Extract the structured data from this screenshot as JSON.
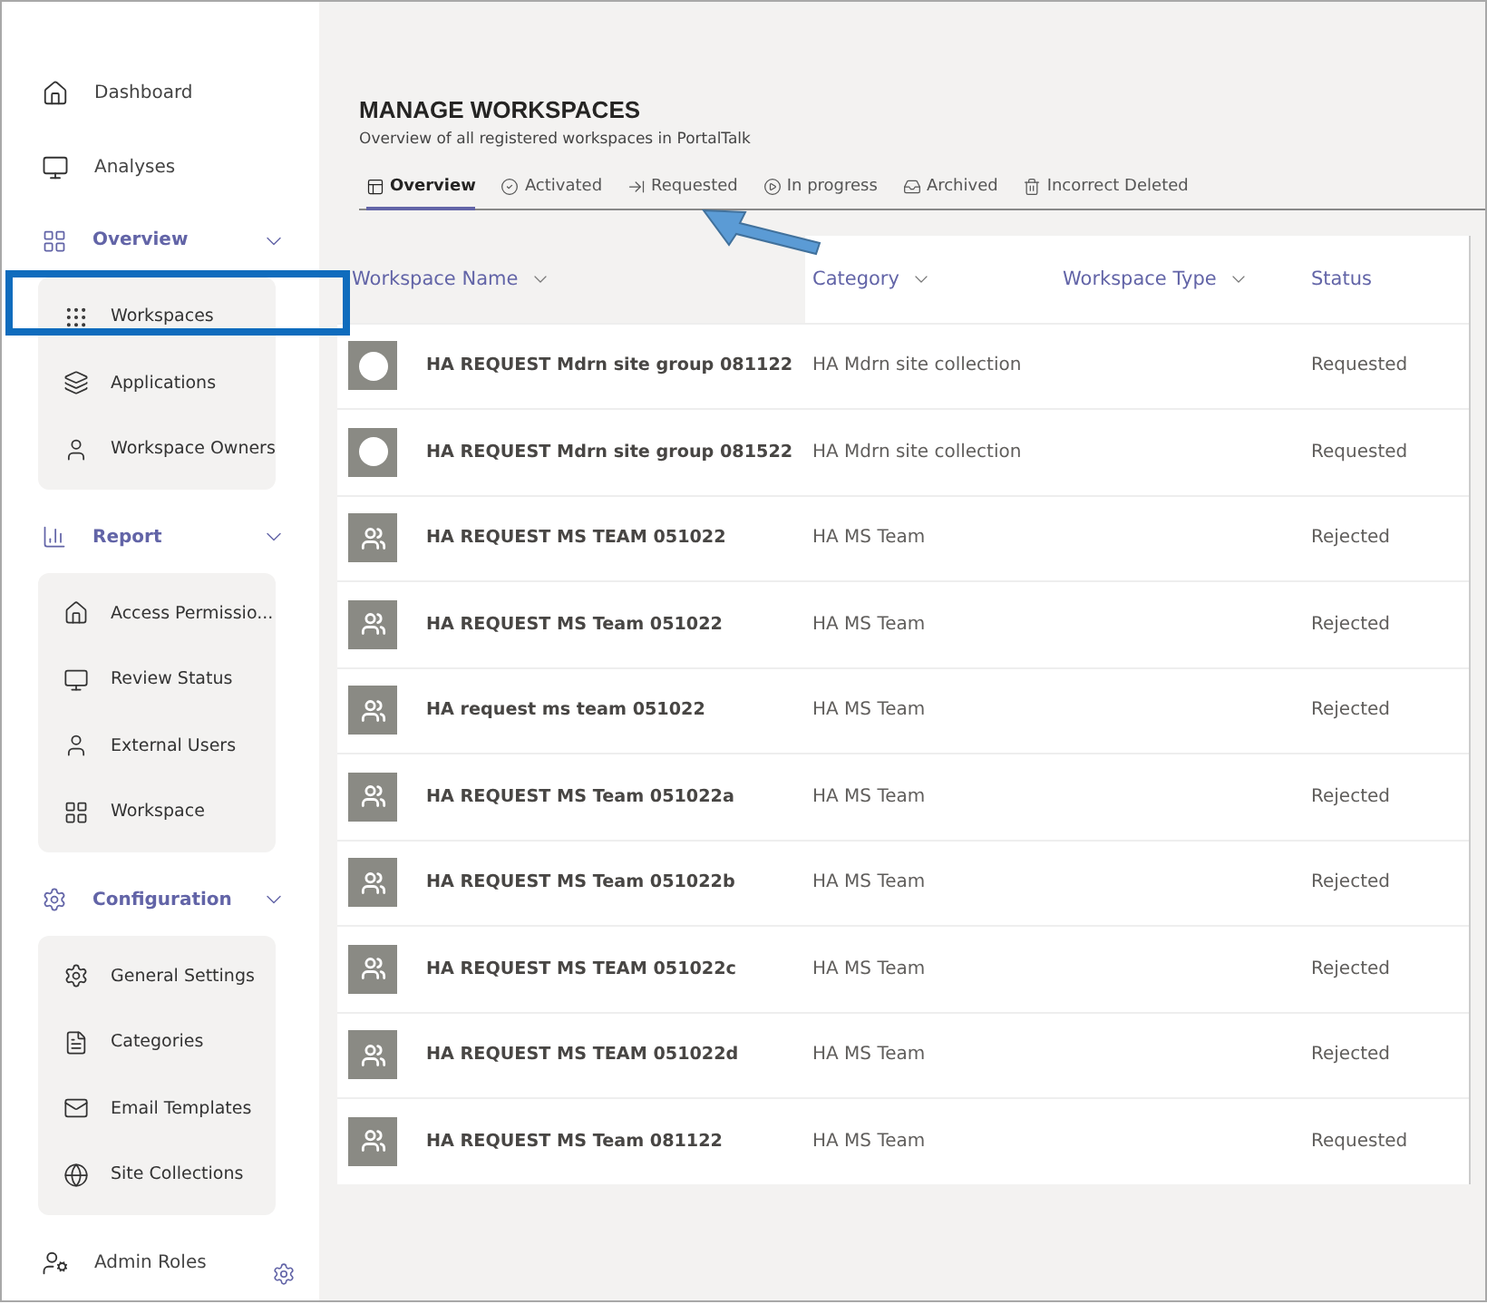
{
  "sidebar": {
    "items": [
      {
        "kind": "link",
        "label": "Dashboard"
      },
      {
        "kind": "link",
        "label": "Analyses"
      },
      {
        "kind": "group",
        "label": "Overview",
        "expanded": true,
        "children": [
          {
            "label": "Workspaces"
          },
          {
            "label": "Applications"
          },
          {
            "label": "Workspace Owners"
          }
        ]
      },
      {
        "kind": "group",
        "label": "Report",
        "expanded": true,
        "children": [
          {
            "label": "Access Permissio..."
          },
          {
            "label": "Review Status"
          },
          {
            "label": "External Users"
          },
          {
            "label": "Workspace"
          }
        ]
      },
      {
        "kind": "group",
        "label": "Configuration",
        "expanded": true,
        "children": [
          {
            "label": "General Settings"
          },
          {
            "label": "Categories"
          },
          {
            "label": "Email Templates"
          },
          {
            "label": "Site Collections"
          }
        ]
      },
      {
        "kind": "link",
        "label": "Admin Roles"
      }
    ]
  },
  "header": {
    "title": "MANAGE WORKSPACES",
    "subtitle": "Overview of all registered workspaces in PortalTalk"
  },
  "tabs": [
    {
      "label": "Overview",
      "selected": true
    },
    {
      "label": "Activated",
      "selected": false
    },
    {
      "label": "Requested",
      "selected": false
    },
    {
      "label": "In progress",
      "selected": false
    },
    {
      "label": "Archived",
      "selected": false
    },
    {
      "label": "Incorrect Deleted",
      "selected": false
    }
  ],
  "table": {
    "columns": [
      {
        "label": "Workspace Name",
        "sortable": true
      },
      {
        "label": "Category",
        "sortable": true
      },
      {
        "label": "Workspace Type",
        "sortable": true
      },
      {
        "label": "Status",
        "sortable": false
      }
    ],
    "rows": [
      {
        "kind": "site",
        "name": "HA REQUEST Mdrn site group 081122",
        "category": "HA Mdrn site collection",
        "status": "Requested"
      },
      {
        "kind": "site",
        "name": "HA REQUEST Mdrn site group 081522",
        "category": "HA Mdrn site collection",
        "status": "Requested"
      },
      {
        "kind": "team",
        "name": "HA REQUEST MS TEAM 051022",
        "category": "HA MS Team",
        "status": "Rejected"
      },
      {
        "kind": "team",
        "name": "HA REQUEST MS Team 051022",
        "category": "HA MS Team",
        "status": "Rejected"
      },
      {
        "kind": "team",
        "name": "HA request ms team 051022",
        "category": "HA MS Team",
        "status": "Rejected"
      },
      {
        "kind": "team",
        "name": "HA REQUEST MS Team 051022a",
        "category": "HA MS Team",
        "status": "Rejected"
      },
      {
        "kind": "team",
        "name": "HA REQUEST MS Team 051022b",
        "category": "HA MS Team",
        "status": "Rejected"
      },
      {
        "kind": "team",
        "name": "HA REQUEST MS TEAM 051022c",
        "category": "HA MS Team",
        "status": "Rejected"
      },
      {
        "kind": "team",
        "name": "HA REQUEST MS TEAM 051022d",
        "category": "HA MS Team",
        "status": "Rejected"
      },
      {
        "kind": "team",
        "name": "HA REQUEST MS Team 081122",
        "category": "HA MS Team",
        "status": "Requested"
      }
    ]
  }
}
